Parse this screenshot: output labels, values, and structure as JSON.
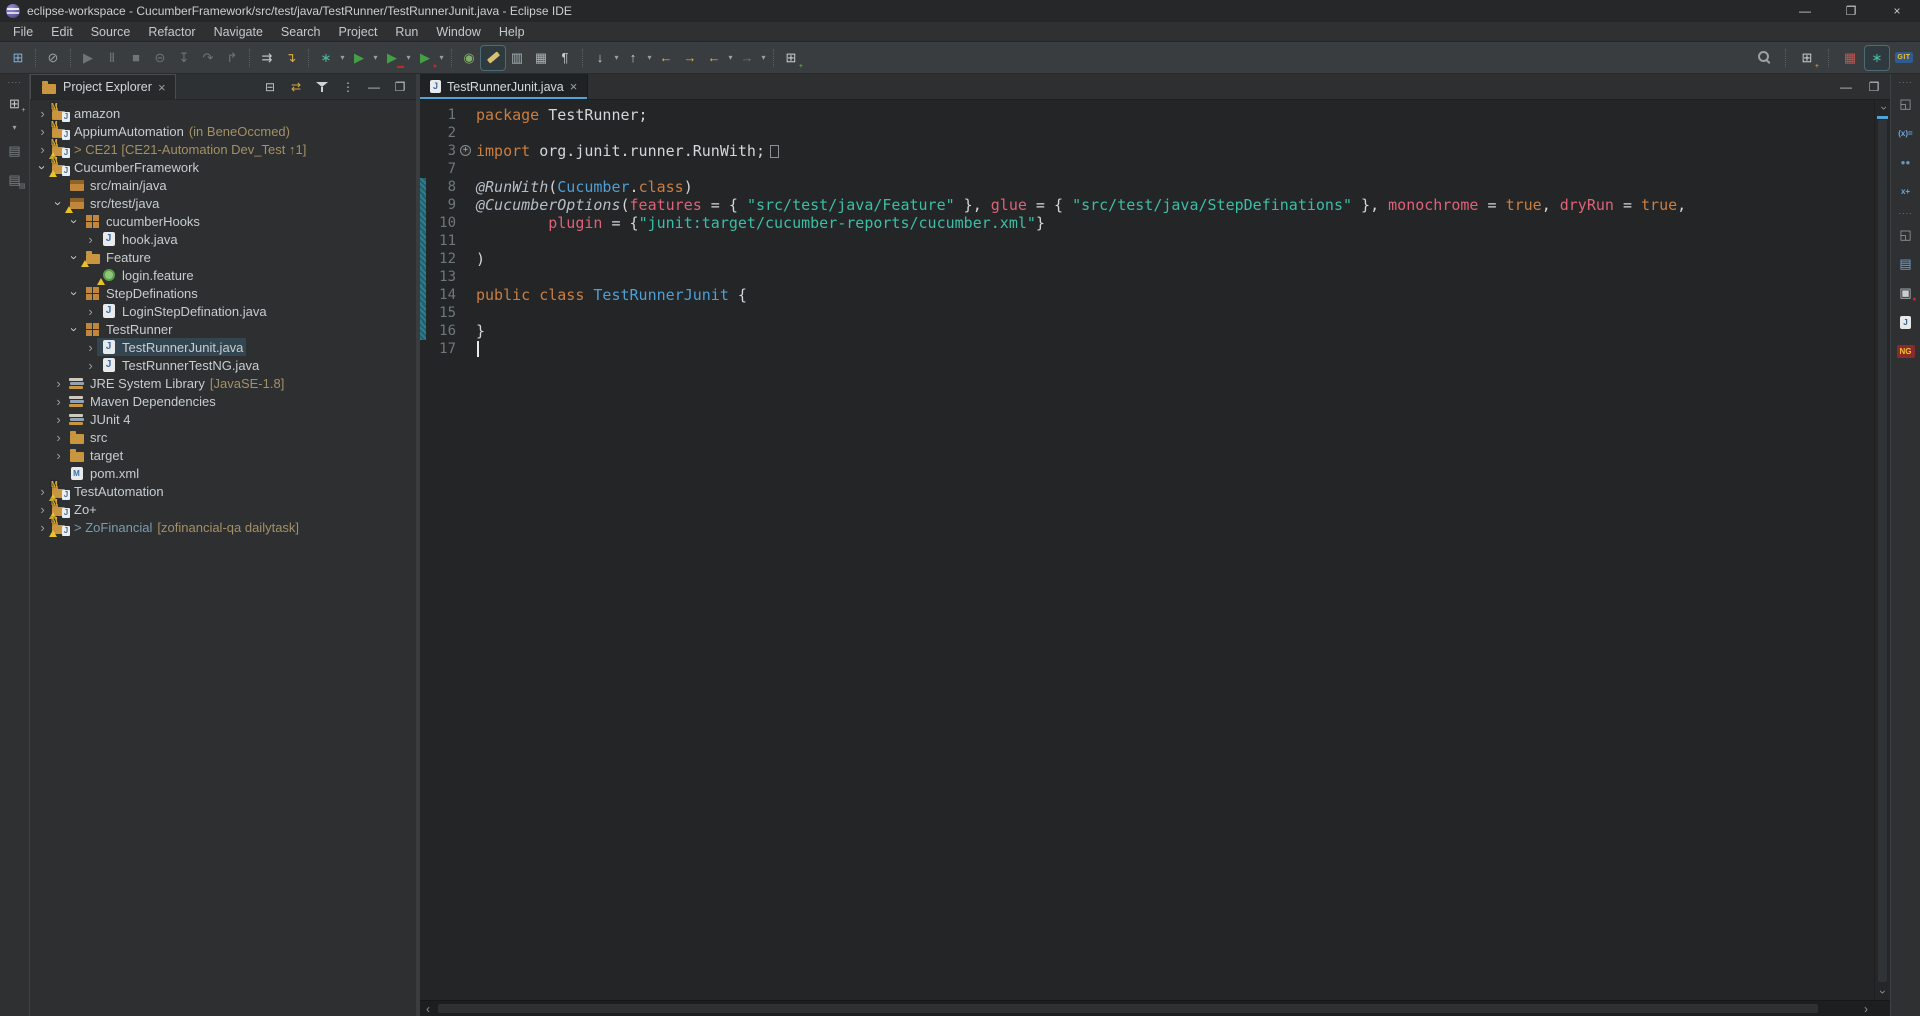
{
  "window": {
    "title": "eclipse-workspace - CucumberFramework/src/test/java/TestRunner/TestRunnerJunit.java - Eclipse IDE",
    "controls": [
      {
        "n": "minimize-button",
        "g": "—"
      },
      {
        "n": "maximize-button",
        "g": "❐"
      },
      {
        "n": "close-button",
        "g": "×"
      }
    ]
  },
  "menu": {
    "items": [
      "File",
      "Edit",
      "Source",
      "Refactor",
      "Navigate",
      "Search",
      "Project",
      "Run",
      "Window",
      "Help"
    ]
  },
  "toolbar": {
    "items": [
      {
        "n": "new-window-icon",
        "g": "⊞",
        "c": "#7FB2DD"
      },
      {
        "sep": 1
      },
      {
        "n": "skip-all-breakpoints-icon",
        "g": "⊘",
        "c": "#9BA1A4"
      },
      {
        "sep": 1
      },
      {
        "n": "resume-icon",
        "g": "▶",
        "c": "#9BA1A4",
        "dis": 1
      },
      {
        "n": "pause-icon",
        "g": "Ⅱ",
        "c": "#9BA1A4",
        "dis": 1
      },
      {
        "n": "terminate-icon",
        "g": "■",
        "c": "#9BA1A4",
        "dis": 1
      },
      {
        "n": "disconnect-icon",
        "g": "⊝",
        "c": "#9BA1A4",
        "dis": 1
      },
      {
        "n": "step-into-icon",
        "g": "↧",
        "c": "#9BA1A4",
        "dis": 1
      },
      {
        "n": "step-over-icon",
        "g": "↷",
        "c": "#9BA1A4",
        "dis": 1
      },
      {
        "n": "step-return-icon",
        "g": "↱",
        "c": "#9BA1A4",
        "dis": 1
      },
      {
        "sep": 1
      },
      {
        "n": "show-skipped-frames-icon",
        "g": "⇉",
        "c": "#C9CDCF"
      },
      {
        "n": "drop-to-frame-icon",
        "g": "↴",
        "c": "#DDAE3C"
      },
      {
        "sep": 1
      },
      {
        "n": "debug-icon",
        "g": "∗",
        "c": "#4DB8A6",
        "dd": 1
      },
      {
        "n": "run-icon",
        "g": "▶",
        "c": "#43A047",
        "dd": 1
      },
      {
        "n": "coverage-icon",
        "g": "▶",
        "c": "#43A047",
        "dd": 1,
        "badge": "▬",
        "bc": "#C62828"
      },
      {
        "n": "profile-icon",
        "g": "▶",
        "c": "#43A047",
        "dd": 1,
        "badge": "●",
        "bc": "#C62828"
      },
      {
        "sep": 1
      },
      {
        "n": "external-tools-icon",
        "g": "◉",
        "c": "#7FB069"
      },
      {
        "n": "mark-occurrences-icon",
        "css": "highlighter",
        "act": 1
      },
      {
        "n": "open-type-icon",
        "g": "▥",
        "c": "#A8B2B8"
      },
      {
        "n": "show-selected-element-icon",
        "g": "▦",
        "c": "#A8B2B8"
      },
      {
        "n": "show-whitespace-icon",
        "g": "¶",
        "c": "#C3C9CC"
      },
      {
        "sep": 1
      },
      {
        "n": "next-annotation-icon",
        "g": "↓",
        "c": "#C9CDCF",
        "dd": 1
      },
      {
        "n": "previous-annotation-icon",
        "g": "↑",
        "c": "#C9CDCF",
        "dd": 1
      },
      {
        "n": "last-edit-location-icon",
        "g": "←",
        "c": "#E3B341"
      },
      {
        "n": "next-edit-location-icon",
        "g": "→",
        "c": "#E3B341"
      },
      {
        "n": "back-icon",
        "g": "←",
        "c": "#E3B341",
        "dd": 1
      },
      {
        "n": "forward-icon",
        "g": "→",
        "c": "#9BA1A4",
        "dd": 1,
        "dis": 1
      },
      {
        "sep": 1
      },
      {
        "n": "open-editor-window-icon",
        "g": "⊞",
        "c": "#C9CDCF",
        "badge": "+",
        "bc": "#6CC24A"
      }
    ],
    "perspectives": [
      {
        "n": "java-perspective-button",
        "g": "▦",
        "c": "#C75450"
      },
      {
        "n": "debug-perspective-button",
        "g": "∗",
        "c": "#4DB8A6",
        "act": 1
      },
      {
        "n": "git-perspective-button",
        "chip": "GIT"
      }
    ]
  },
  "left_strip": {
    "items": [
      {
        "n": "drag-handle",
        "handle": 1
      },
      {
        "n": "open-view-icon",
        "g": "⊞",
        "c": "#C9CDCF",
        "badge": "+",
        "bc": "#E3B341",
        "dd": 1
      },
      {
        "n": "save-icon",
        "g": "▤",
        "c": "#7D8285"
      },
      {
        "n": "save-all-icon",
        "g": "▤",
        "c": "#7D8285",
        "badge": "▤",
        "bc": "#7D8285"
      }
    ]
  },
  "right_strip": {
    "items": [
      {
        "n": "drag-handle",
        "handle": 1
      },
      {
        "n": "restore-view-icon",
        "g": "◱",
        "c": "#9BA1A4"
      },
      {
        "n": "variables-icon",
        "txt": "(x)=",
        "c": "#6FA8DC"
      },
      {
        "n": "breakpoints-icon",
        "txt": "●●",
        "c": "#5C9CCC"
      },
      {
        "n": "expressions-icon",
        "txt": "x+",
        "c": "#6FA8DC"
      },
      {
        "n": "drag-handle",
        "handle": 1
      },
      {
        "n": "restore-view-icon",
        "g": "◱",
        "c": "#9BA1A4"
      },
      {
        "n": "console-icon",
        "g": "▤",
        "c": "#6FA8DC"
      },
      {
        "n": "display-icon",
        "g": "▣",
        "c": "#C9CDCF",
        "badge": "●",
        "bc": "#C62828"
      },
      {
        "n": "junit-icon",
        "chip": "J",
        "chipbg": "#E8E8E8",
        "chipfg": "#2F5B8E"
      },
      {
        "n": "testng-icon",
        "chip": "NG",
        "chipbg": "#8A2B2B",
        "chipfg": "#F2C230"
      }
    ]
  },
  "explorer": {
    "tab": {
      "label": "Project Explorer",
      "close": "×"
    },
    "header_icons": [
      {
        "n": "collapse-all-icon",
        "g": "⊟"
      },
      {
        "n": "link-with-editor-icon",
        "g": "⇄",
        "cls": "yellow"
      },
      {
        "n": "filter-icon",
        "css": "funnel"
      },
      {
        "n": "view-menu-icon",
        "g": "⋮"
      },
      {
        "n": "minimize-view-icon",
        "g": "—"
      },
      {
        "n": "maximize-view-icon",
        "g": "❐"
      }
    ],
    "tree": [
      {
        "label": "amazon",
        "icon": "prj",
        "depth": 0,
        "expand": "closed"
      },
      {
        "label": "AppiumAutomation",
        "suffix": " (in BeneOccmed)",
        "icon": "prj",
        "depth": 0,
        "expand": "closed"
      },
      {
        "label": "> CE21 [CE21-Automation Dev_Test ↑1]",
        "icon": "prj",
        "warn": 1,
        "depth": 0,
        "expand": "closed",
        "color": "#A49065"
      },
      {
        "label": "CucumberFramework",
        "icon": "prj",
        "warn": 1,
        "depth": 0,
        "expand": "open"
      },
      {
        "label": "src/main/java",
        "icon": "srcroot",
        "depth": 1
      },
      {
        "label": "src/test/java",
        "icon": "srcroot",
        "warn": 1,
        "depth": 1,
        "expand": "open"
      },
      {
        "label": "cucumberHooks",
        "icon": "pkg",
        "depth": 2,
        "expand": "open"
      },
      {
        "label": "hook.java",
        "icon": "java",
        "depth": 3,
        "expand": "closed"
      },
      {
        "label": "Feature",
        "icon": "folder",
        "warn": 1,
        "depth": 2,
        "expand": "open"
      },
      {
        "label": "login.feature",
        "icon": "feature",
        "warn": 1,
        "depth": 3
      },
      {
        "label": "StepDefinations",
        "icon": "pkg",
        "depth": 2,
        "expand": "open"
      },
      {
        "label": "LoginStepDefination.java",
        "icon": "java",
        "depth": 3,
        "expand": "closed"
      },
      {
        "label": "TestRunner",
        "icon": "pkg",
        "depth": 2,
        "expand": "open"
      },
      {
        "label": "TestRunnerJunit.java",
        "icon": "java",
        "depth": 3,
        "expand": "closed",
        "selected": 1
      },
      {
        "label": "TestRunnerTestNG.java",
        "icon": "java",
        "depth": 3,
        "expand": "closed"
      },
      {
        "label": "JRE System Library",
        "suffix": " [JavaSE-1.8]",
        "icon": "lib",
        "depth": 1,
        "expand": "closed"
      },
      {
        "label": "Maven Dependencies",
        "icon": "lib",
        "depth": 1,
        "expand": "closed"
      },
      {
        "label": "JUnit 4",
        "icon": "lib",
        "depth": 1,
        "expand": "closed"
      },
      {
        "label": "src",
        "icon": "folder",
        "depth": 1,
        "expand": "closed"
      },
      {
        "label": "target",
        "icon": "folder",
        "depth": 1,
        "expand": "closed"
      },
      {
        "label": "pom.xml",
        "icon": "pom",
        "depth": 1
      },
      {
        "label": "TestAutomation",
        "icon": "prj",
        "warn": 1,
        "depth": 0,
        "expand": "closed"
      },
      {
        "label": "Zo+",
        "icon": "prj",
        "warn": 1,
        "depth": 0,
        "expand": "closed"
      },
      {
        "label": "> ZoFinancial",
        "suffix": " [zofinancial-qa dailytask]",
        "icon": "prj",
        "warn": 1,
        "depth": 0,
        "expand": "closed",
        "color": "#7C9BAD"
      }
    ]
  },
  "editor": {
    "tab": {
      "label": "TestRunnerJunit.java",
      "close": "×"
    },
    "header_icons": [
      {
        "n": "minimize-editor-icon",
        "g": "—"
      },
      {
        "n": "maximize-editor-icon",
        "g": "❐"
      }
    ],
    "scroll": {
      "left": "‹",
      "right": "›",
      "up": "‹",
      "down": "›"
    },
    "lines": [
      {
        "n": "1",
        "t": [
          [
            "kw",
            "package"
          ],
          [
            "pl",
            " TestRunner;"
          ]
        ]
      },
      {
        "n": "2",
        "t": []
      },
      {
        "n": "3",
        "fold": 1,
        "foldbox": 1,
        "t": [
          [
            "kw",
            "import"
          ],
          [
            "pl",
            " org.junit.runner.RunWith;"
          ]
        ]
      },
      {
        "n": "7",
        "t": []
      },
      {
        "n": "8",
        "ri": 1,
        "t": [
          [
            "an",
            "@RunWith"
          ],
          [
            "pl",
            "("
          ],
          [
            "cl",
            "Cucumber"
          ],
          [
            "pl",
            "."
          ],
          [
            "kw",
            "class"
          ],
          [
            "pl",
            ")"
          ]
        ]
      },
      {
        "n": "9",
        "ri": 1,
        "t": [
          [
            "an",
            "@CucumberOptions"
          ],
          [
            "pl",
            "("
          ],
          [
            "at",
            "features"
          ],
          [
            "pl",
            " = { "
          ],
          [
            "st",
            "\"src/test/java/Feature\""
          ],
          [
            "pl",
            " }, "
          ],
          [
            "at",
            "glue"
          ],
          [
            "pl",
            " = { "
          ],
          [
            "st",
            "\"src/test/java/StepDefinations\""
          ],
          [
            "pl",
            " }, "
          ],
          [
            "at",
            "monochrome"
          ],
          [
            "pl",
            " = "
          ],
          [
            "kw",
            "true"
          ],
          [
            "pl",
            ", "
          ],
          [
            "at",
            "dryRun"
          ],
          [
            "pl",
            " = "
          ],
          [
            "kw",
            "true"
          ],
          [
            "pl",
            ","
          ]
        ]
      },
      {
        "n": "10",
        "ri": 1,
        "t": [
          [
            "pl",
            "        "
          ],
          [
            "at",
            "plugin"
          ],
          [
            "pl",
            " = {"
          ],
          [
            "st",
            "\"junit:target/cucumber-reports/cucumber.xml\""
          ],
          [
            "pl",
            "}"
          ]
        ]
      },
      {
        "n": "11",
        "ri": 1,
        "t": []
      },
      {
        "n": "12",
        "ri": 1,
        "t": [
          [
            "pl",
            ")"
          ]
        ]
      },
      {
        "n": "13",
        "ri": 1,
        "t": []
      },
      {
        "n": "14",
        "ri": 1,
        "t": [
          [
            "kw",
            "public"
          ],
          [
            "pl",
            " "
          ],
          [
            "kw",
            "class"
          ],
          [
            "pl",
            " "
          ],
          [
            "cl",
            "TestRunnerJunit"
          ],
          [
            "pl",
            " {"
          ]
        ]
      },
      {
        "n": "15",
        "ri": 1,
        "t": []
      },
      {
        "n": "16",
        "ri": 1,
        "t": [
          [
            "pl",
            "}"
          ]
        ]
      },
      {
        "n": "17",
        "cursor": 1,
        "t": []
      }
    ]
  }
}
